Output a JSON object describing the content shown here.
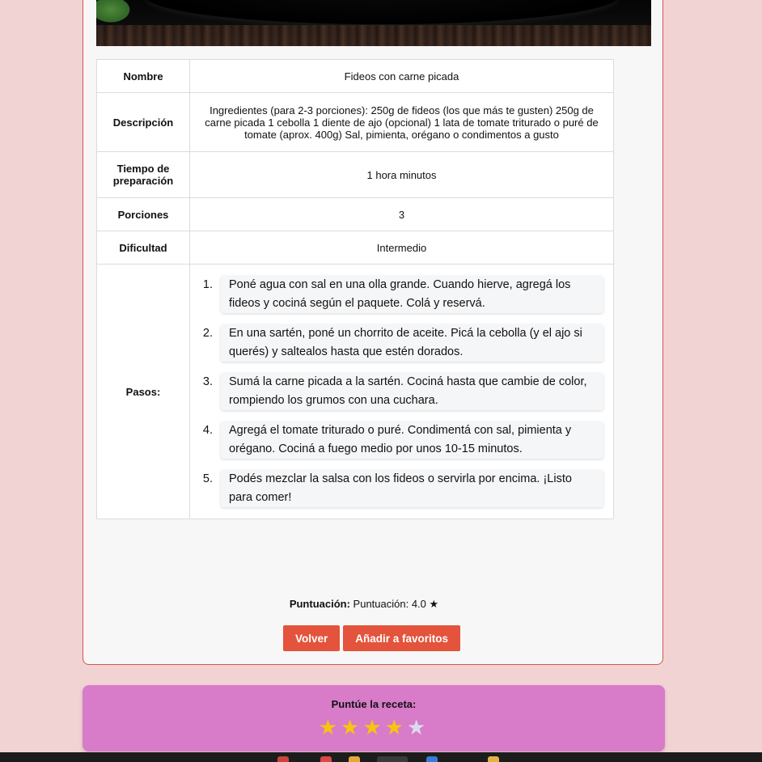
{
  "recipe": {
    "rows": {
      "nombre_label": "Nombre",
      "nombre_value": "Fideos con carne picada",
      "descripcion_label": "Descripción",
      "descripcion_value": "Ingredientes (para 2-3 porciones): 250g de fideos (los que más te gusten) 250g de carne picada 1 cebolla 1 diente de ajo (opcional) 1 lata de tomate triturado o puré de tomate (aprox. 400g) Sal, pimienta, orégano o condimentos a gusto",
      "tiempo_label": "Tiempo de preparación",
      "tiempo_value": "1 hora minutos",
      "porciones_label": "Porciones",
      "porciones_value": "3",
      "dificultad_label": "Dificultad",
      "dificultad_value": "Intermedio",
      "pasos_label": "Pasos:"
    },
    "steps": [
      "Poné agua con sal en una olla grande. Cuando hierve, agregá los fideos y cociná según el paquete. Colá y reservá.",
      "En una sartén, poné un chorrito de aceite. Picá la cebolla (y el ajo si querés) y saltealos hasta que estén dorados.",
      "Sumá la carne picada a la sartén. Cociná hasta que cambie de color, rompiendo los grumos con una cuchara.",
      "Agregá el tomate triturado o puré. Condimentá con sal, pimienta y orégano. Cociná a fuego medio por unos 10-15 minutos.",
      "Podés mezclar la salsa con los fideos o servirla por encima. ¡Listo para comer!"
    ]
  },
  "score": {
    "label": "Puntuación:",
    "value_text": "Puntuación: 4.0 ★"
  },
  "buttons": {
    "back": "Volver",
    "favorite": "Añadir a favoritos"
  },
  "rating": {
    "title": "Puntúe la receta:",
    "star_glyph": "★",
    "filled": 4,
    "total": 5
  },
  "colors": {
    "background": "#f1d3d4",
    "button": "#e4533b",
    "rating_box": "#d87bc9",
    "star_on": "#f8c40d",
    "star_off": "#d9dcef"
  }
}
